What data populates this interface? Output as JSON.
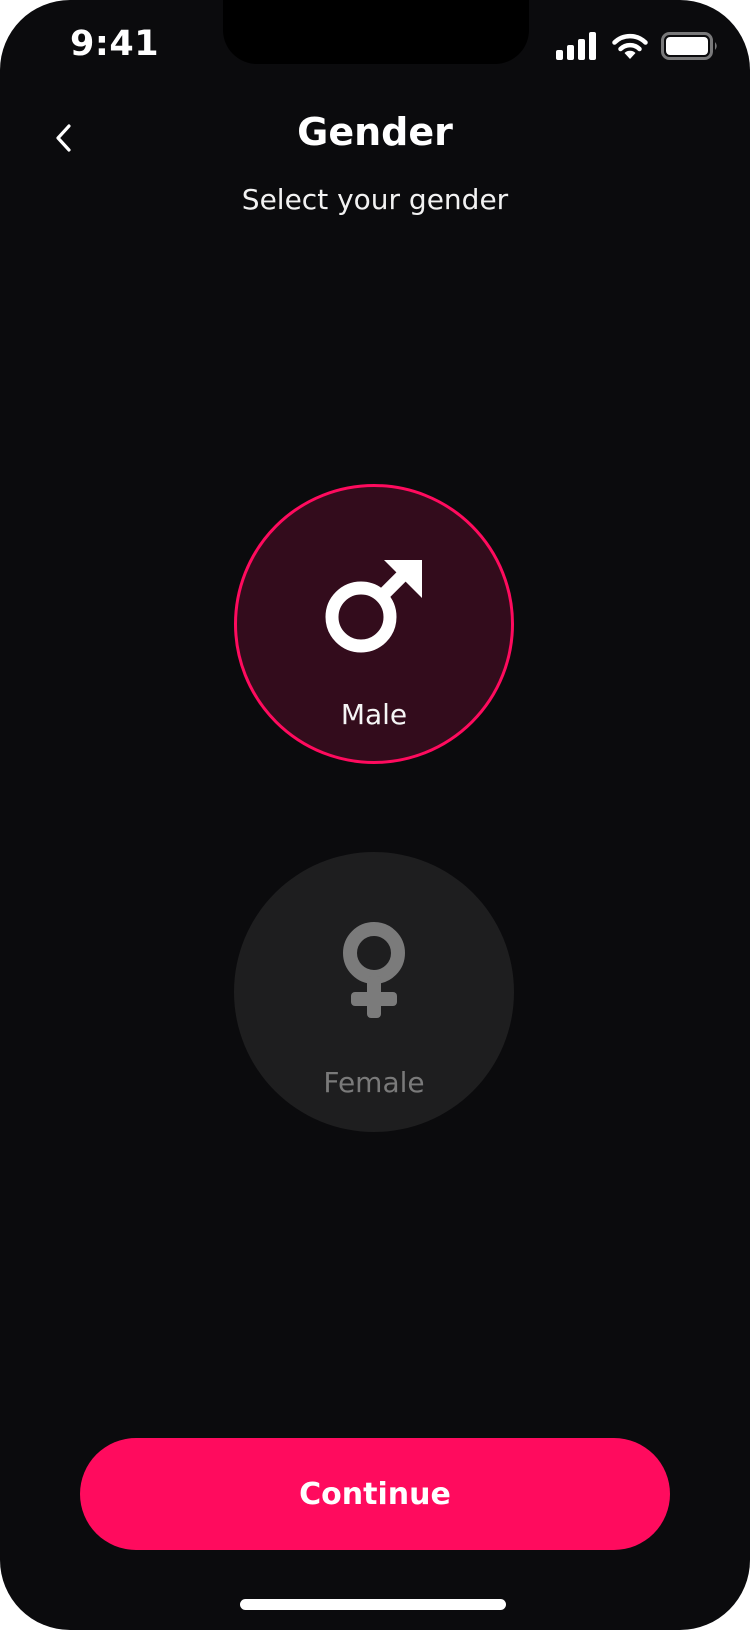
{
  "status_bar": {
    "time": "9:41",
    "icons": [
      "cellular-signal-icon",
      "wifi-icon",
      "battery-icon"
    ]
  },
  "header": {
    "back_icon": "chevron-left-icon",
    "title": "Gender",
    "subtitle": "Select your gender"
  },
  "options": [
    {
      "label": "Male",
      "icon": "male-symbol-icon",
      "selected": true
    },
    {
      "label": "Female",
      "icon": "female-symbol-icon",
      "selected": false
    }
  ],
  "footer": {
    "continue_label": "Continue"
  },
  "colors": {
    "background": "#0b0b0d",
    "accent": "#ff0b5e",
    "selected_fill": "#330c1c",
    "unselected_fill": "#1e1e1f",
    "unselected_text": "#7a7a7a"
  }
}
